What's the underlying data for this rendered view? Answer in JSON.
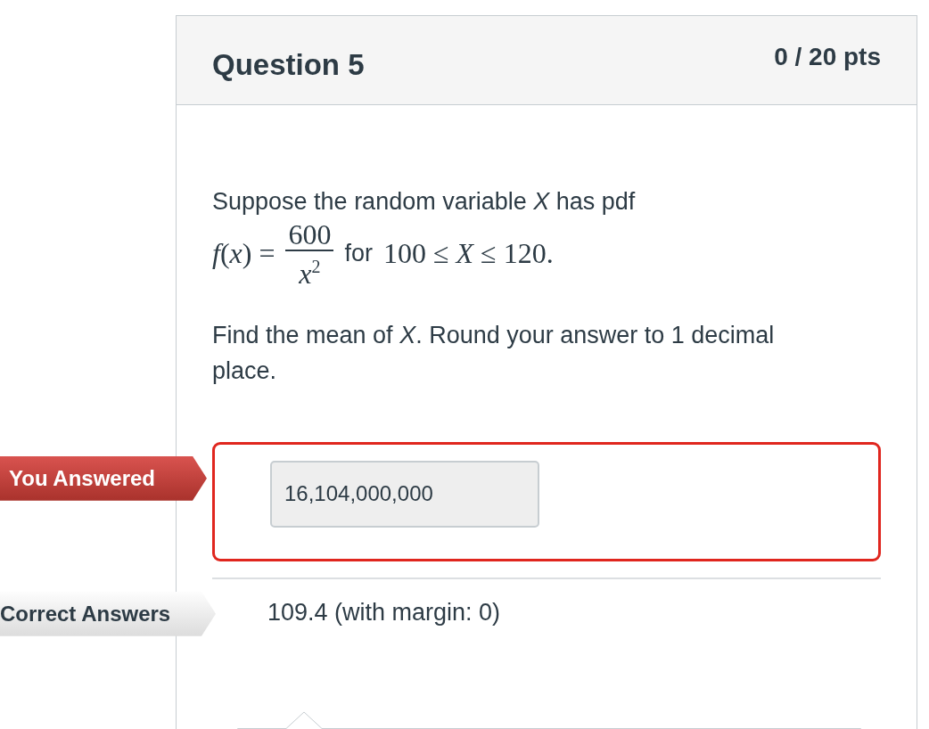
{
  "question": {
    "title": "Question 5",
    "points": "0 / 20 pts"
  },
  "prompt": {
    "intro": "Suppose the random variable *X* has pdf",
    "formula": {
      "lhs": "*f*(*x*) =",
      "numerator": "600",
      "denominator": "*x*$^{2}$",
      "connector": "for",
      "range": "100 ≤ *X* ≤ 120."
    },
    "task": "Find the mean of *X*. Round your answer to 1 decimal place."
  },
  "answers": [
    {
      "kind": "user",
      "label": "You Answered",
      "value": "16,104,000,000"
    },
    {
      "kind": "correct",
      "label": "Correct Answers",
      "value": "109.4 (with margin: 0)"
    }
  ]
}
